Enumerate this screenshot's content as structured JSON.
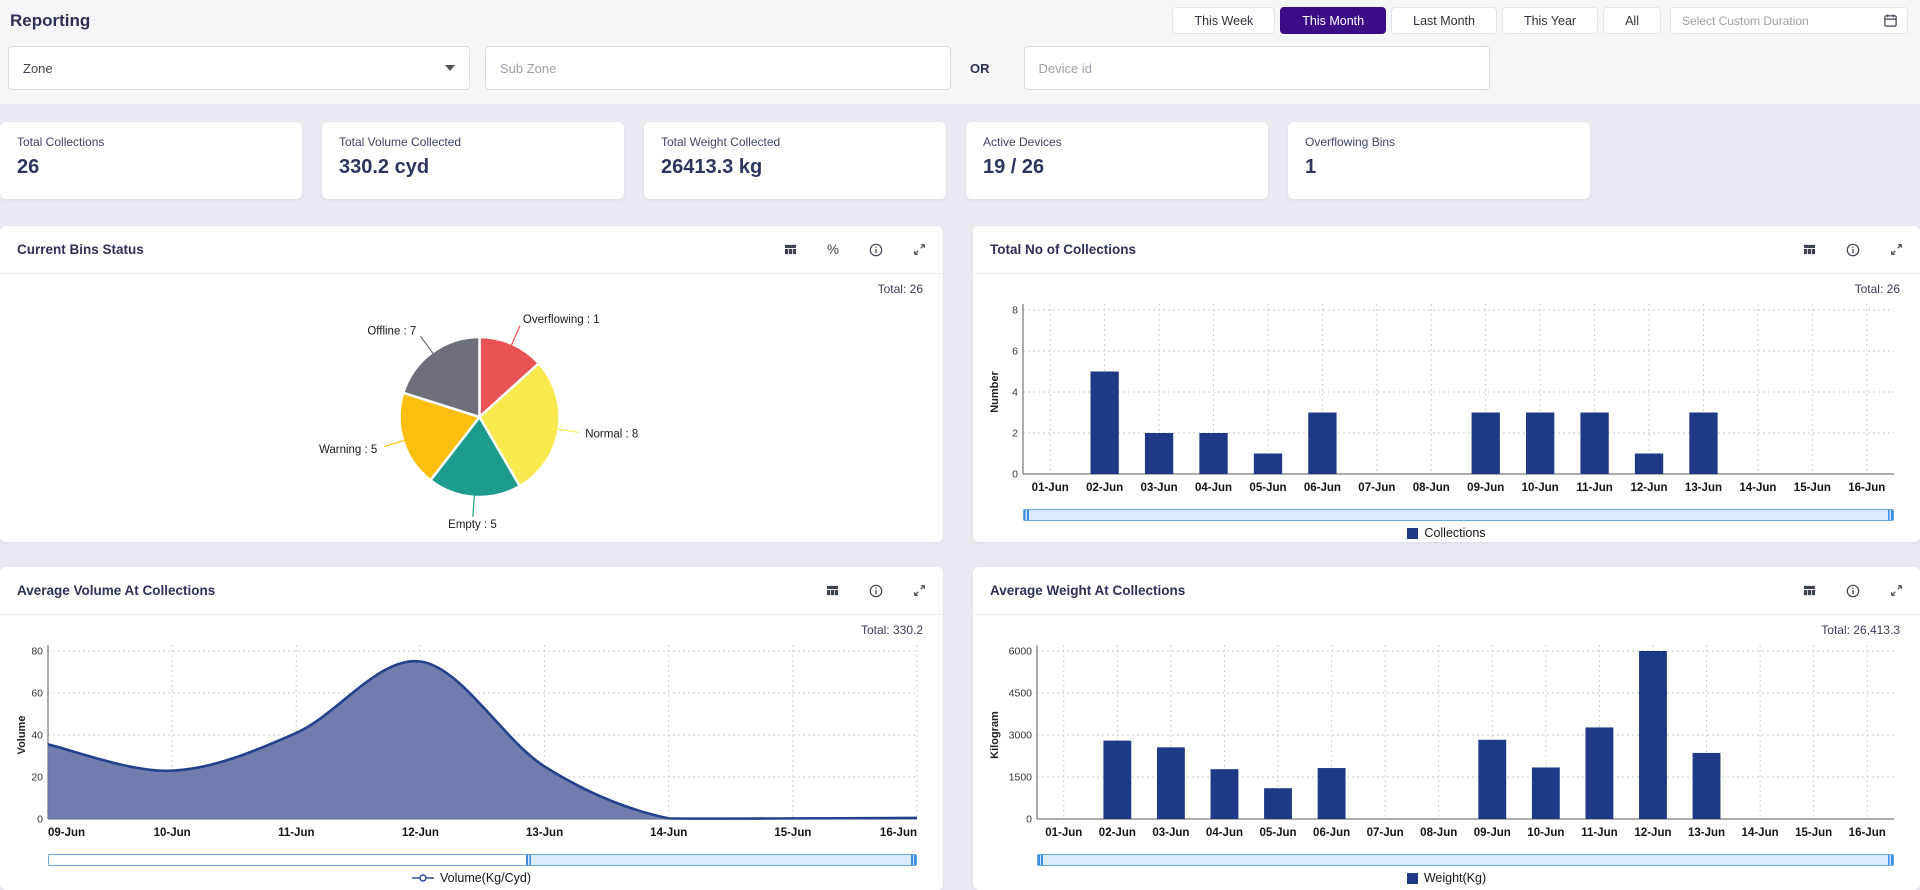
{
  "header": {
    "title": "Reporting"
  },
  "time_filters": {
    "buttons": [
      {
        "label": "This Week",
        "selected": false
      },
      {
        "label": "This Month",
        "selected": true
      },
      {
        "label": "Last Month",
        "selected": false
      },
      {
        "label": "This Year",
        "selected": false
      },
      {
        "label": "All",
        "selected": false
      }
    ],
    "custom_duration_placeholder": "Select Custom Duration"
  },
  "filters": {
    "zone_value": "Zone",
    "subzone_placeholder": "Sub Zone",
    "or_label": "OR",
    "device_placeholder": "Device id"
  },
  "kpis": [
    {
      "label": "Total Collections",
      "value": "26"
    },
    {
      "label": "Total Volume Collected",
      "value": "330.2 cyd"
    },
    {
      "label": "Total Weight Collected",
      "value": "26413.3 kg"
    },
    {
      "label": "Active Devices",
      "value": "19 / 26"
    },
    {
      "label": "Overflowing Bins",
      "value": "1"
    }
  ],
  "icons": {
    "percent_glyph": "%"
  },
  "colors": {
    "selected_filter_bg": "#3a0c86",
    "bar_navy": "#1e3a86",
    "slider_fill": "#d9ebfd",
    "slider_handle": "#3c8ce4"
  },
  "chart_data": [
    {
      "id": "bins-status",
      "type": "pie",
      "title": "Current Bins Status",
      "total_label": "Total: 26",
      "slices": [
        {
          "label": "Overflowing",
          "value": 1,
          "color": "#ea5356",
          "display_fraction": 0.133
        },
        {
          "label": "Normal",
          "value": 8,
          "color": "#f8e94e",
          "display_fraction": 0.283
        },
        {
          "label": "Empty",
          "value": 5,
          "color": "#1d9b8c",
          "display_fraction": 0.189
        },
        {
          "label": "Warning",
          "value": 5,
          "color": "#fcbf10",
          "display_fraction": 0.194
        },
        {
          "label": "Offline",
          "value": 7,
          "color": "#6b707a",
          "display_fraction": 0.201
        }
      ]
    },
    {
      "id": "collections",
      "type": "bar",
      "title": "Total No of Collections",
      "total_label": "Total: 26",
      "categories": [
        "01-Jun",
        "02-Jun",
        "03-Jun",
        "04-Jun",
        "05-Jun",
        "06-Jun",
        "07-Jun",
        "08-Jun",
        "09-Jun",
        "10-Jun",
        "11-Jun",
        "12-Jun",
        "13-Jun",
        "14-Jun",
        "15-Jun",
        "16-Jun"
      ],
      "values": [
        0,
        5,
        2,
        2,
        1,
        3,
        0,
        0,
        3,
        3,
        3,
        1,
        3,
        0,
        0,
        0
      ],
      "ylabel": "Number",
      "yticks": [
        0,
        2,
        4,
        6,
        8
      ],
      "ylim": [
        0,
        8
      ],
      "bar_color": "#1e3a86",
      "left_margin": 36,
      "legend": {
        "label": "Collections",
        "marker": "square"
      },
      "scrollbar": {
        "start": 0,
        "end": 1
      }
    },
    {
      "id": "avg-volume",
      "type": "area",
      "title": "Average Volume At Collections",
      "total_label": "Total: 330.2",
      "categories": [
        "09-Jun",
        "10-Jun",
        "11-Jun",
        "12-Jun",
        "13-Jun",
        "14-Jun",
        "15-Jun",
        "16-Jun"
      ],
      "values": [
        35.5,
        23,
        41,
        75,
        25,
        0.3,
        0.3,
        0.5
      ],
      "ylabel": "Volume",
      "yticks": [
        0,
        20,
        40,
        60,
        80
      ],
      "ylim": [
        0,
        80
      ],
      "line_color": "#23418c",
      "fill_color": "#6b76a9",
      "left_margin": 34,
      "legend": {
        "label": "Volume(Kg/Cyd)",
        "marker": "line-circle"
      },
      "scrollbar": {
        "start": 0.55,
        "end": 1
      }
    },
    {
      "id": "avg-weight",
      "type": "bar",
      "title": "Average Weight At Collections",
      "total_label": "Total: 26,413.3",
      "categories": [
        "01-Jun",
        "02-Jun",
        "03-Jun",
        "04-Jun",
        "05-Jun",
        "06-Jun",
        "07-Jun",
        "08-Jun",
        "09-Jun",
        "10-Jun",
        "11-Jun",
        "12-Jun",
        "13-Jun",
        "14-Jun",
        "15-Jun",
        "16-Jun"
      ],
      "values": [
        0,
        2800,
        2560,
        1780,
        1100,
        1820,
        0,
        0,
        2830,
        1840,
        3270,
        6000,
        2360,
        0,
        0,
        0
      ],
      "ylabel": "Kilogram",
      "yticks": [
        0,
        1500,
        3000,
        4500,
        6000
      ],
      "ylim": [
        0,
        6000
      ],
      "bar_color": "#1e3a86",
      "left_margin": 50,
      "legend": {
        "label": "Weight(Kg)",
        "marker": "square"
      },
      "scrollbar": {
        "start": 0,
        "end": 1
      }
    }
  ]
}
